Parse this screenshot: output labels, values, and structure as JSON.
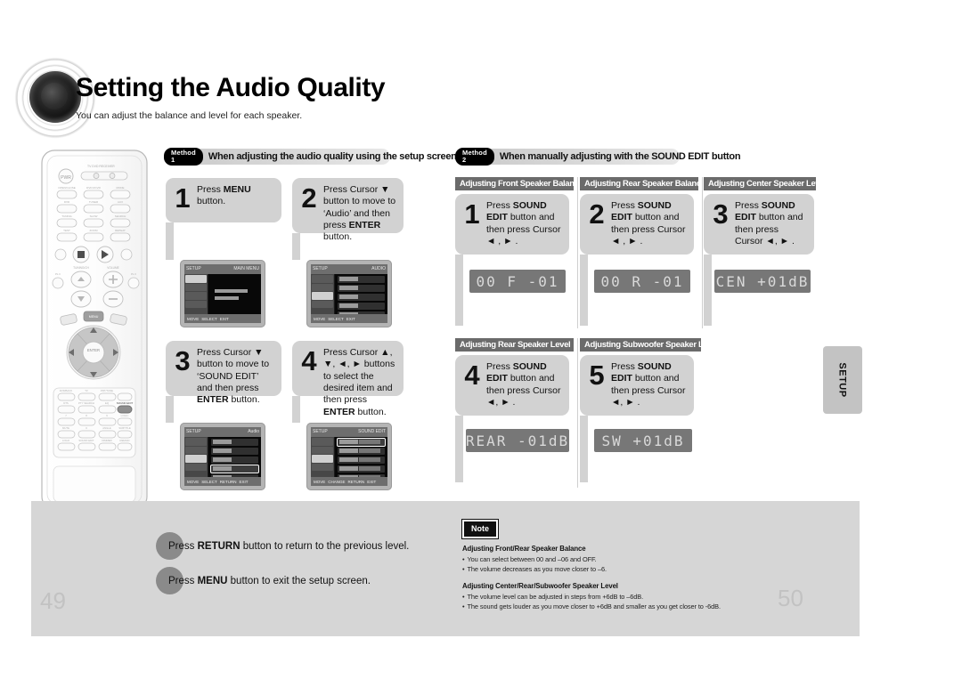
{
  "page": {
    "title": "Setting the Audio Quality",
    "subtitle": "You can adjust the balance and level for each speaker.",
    "left_page_number": "49",
    "right_page_number": "50",
    "side_tab_label": "SETUP"
  },
  "method1": {
    "tag": "Method 1",
    "heading": "When adjusting the audio quality using the setup screen",
    "steps": [
      {
        "number": "1",
        "text_parts": [
          {
            "t": "Press ",
            "b": false
          },
          {
            "t": "MENU",
            "b": true
          },
          {
            "t": " button.",
            "b": false
          }
        ],
        "screen": "main-menu"
      },
      {
        "number": "2",
        "text_parts": [
          {
            "t": "Press Cursor ▼ button to move to ‘Audio’ and then press ",
            "b": false
          },
          {
            "t": "ENTER",
            "b": true
          },
          {
            "t": " button.",
            "b": false
          }
        ],
        "screen": "audio-menu"
      },
      {
        "number": "3",
        "text_parts": [
          {
            "t": "Press Cursor ▼ button to move to ‘SOUND EDIT’ and then press ",
            "b": false
          },
          {
            "t": "ENTER",
            "b": true
          },
          {
            "t": " button.",
            "b": false
          }
        ],
        "screen": "sound-edit-highlight"
      },
      {
        "number": "4",
        "text_parts": [
          {
            "t": "Press Cursor ▲, ▼, ◄, ► buttons to select the desired item and then press ",
            "b": false
          },
          {
            "t": "ENTER",
            "b": true
          },
          {
            "t": " button.",
            "b": false
          }
        ],
        "screen": "sound-edit-sliders"
      }
    ]
  },
  "method2": {
    "tag": "Method 2",
    "heading": "When manually adjusting with the SOUND EDIT button",
    "panels": [
      {
        "section_title": "Adjusting Front Speaker Balance",
        "number": "1",
        "text_parts": [
          {
            "t": "Press ",
            "b": false
          },
          {
            "t": "SOUND EDIT",
            "b": true
          },
          {
            "t": " button and then press Cursor ◄ , ► .",
            "b": false
          }
        ],
        "lcd": "00 F -01"
      },
      {
        "section_title": "Adjusting Rear Speaker Balance",
        "number": "2",
        "text_parts": [
          {
            "t": "Press ",
            "b": false
          },
          {
            "t": "SOUND EDIT",
            "b": true
          },
          {
            "t": " button and then press Cursor ◄ , ► .",
            "b": false
          }
        ],
        "lcd": "00 R -01"
      },
      {
        "section_title": "Adjusting Center Speaker Level",
        "number": "3",
        "text_parts": [
          {
            "t": "Press ",
            "b": false
          },
          {
            "t": "SOUND EDIT",
            "b": true
          },
          {
            "t": " button and then press Cursor ◄, ► .",
            "b": false
          }
        ],
        "lcd": "CEN +01dB"
      },
      {
        "section_title": "Adjusting Rear Speaker Level",
        "number": "4",
        "text_parts": [
          {
            "t": "Press ",
            "b": false
          },
          {
            "t": "SOUND EDIT",
            "b": true
          },
          {
            "t": " button and then press Cursor ◄, ► .",
            "b": false
          }
        ],
        "lcd": "REAR -01dB"
      },
      {
        "section_title": "Adjusting Subwoofer Speaker Level",
        "number": "5",
        "text_parts": [
          {
            "t": "Press ",
            "b": false
          },
          {
            "t": "SOUND EDIT",
            "b": true
          },
          {
            "t": " button and then press Cursor ◄, ► .",
            "b": false
          }
        ],
        "lcd": "SW +01dB"
      }
    ]
  },
  "footer_bullets": [
    [
      {
        "t": "Press ",
        "b": false
      },
      {
        "t": "RETURN",
        "b": true
      },
      {
        "t": " button to return to the previous level.",
        "b": false
      }
    ],
    [
      {
        "t": "Press ",
        "b": false
      },
      {
        "t": "MENU",
        "b": true
      },
      {
        "t": " button to exit the setup screen.",
        "b": false
      }
    ]
  ],
  "note": {
    "badge": "Note",
    "groups": [
      {
        "heading": "Adjusting Front/Rear Speaker Balance",
        "items": [
          "You can select between 00 and –06 and OFF.",
          "The volume decreases as you move closer to –6."
        ]
      },
      {
        "heading": "Adjusting Center/Rear/Subwoofer Speaker Level",
        "items": [
          "The volume level can be adjusted in steps from +6dB to –6dB.",
          "The sound gets louder as you move closer to +6dB and smaller as you get closer to -6dB."
        ]
      }
    ]
  },
  "colors": {
    "band": "#d6d6d6",
    "bubble": "#d2d2d2",
    "section_title": "#6b6b6b",
    "lcd_bg": "#777777",
    "lcd_fg": "#d9d9d9",
    "tag_bg": "#000000"
  }
}
